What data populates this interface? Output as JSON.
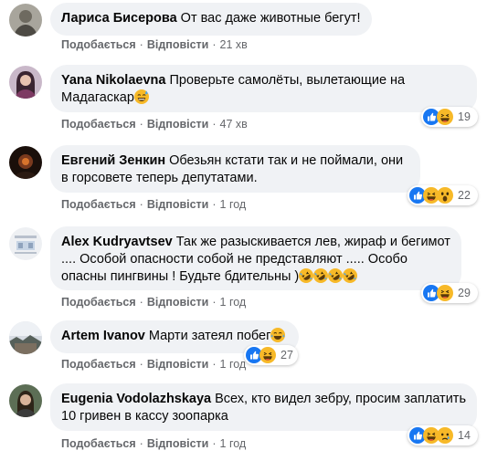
{
  "comments": [
    {
      "author": "Лариса Бисерова",
      "text": "От вас даже животные бегут!",
      "like": "Подобається",
      "reply": "Відповісти",
      "time": "21 хв"
    },
    {
      "author": "Yana Nikolaevna",
      "text": "Проверьте самолёты, вылетающие на Мадагаскар",
      "emoji": "grinning-sweat-emoji",
      "like": "Подобається",
      "reply": "Відповісти",
      "time": "47 хв",
      "reactions": {
        "icons": [
          "like-reaction-icon",
          "haha-reaction-icon"
        ],
        "count": "19"
      }
    },
    {
      "author": "Евгений Зенкин",
      "text": "Обезьян кстати так и не поймали, они в горсовете теперь депутатами.",
      "like": "Подобається",
      "reply": "Відповісти",
      "time": "1 год",
      "reactions": {
        "icons": [
          "like-reaction-icon",
          "haha-reaction-icon",
          "wow-reaction-icon"
        ],
        "count": "22"
      }
    },
    {
      "author": "Alex Kudryavtsev",
      "text": "Так же разыскивается лев, жираф и бегимот .... Особой опасности собой не представляют ..... Особо опасны пингвины ! Будьте бдительны )",
      "emoji": "rofl-emoji x4",
      "like": "Подобається",
      "reply": "Відповісти",
      "time": "1 год",
      "reactions": {
        "icons": [
          "like-reaction-icon",
          "haha-reaction-icon"
        ],
        "count": "29"
      }
    },
    {
      "author": "Artem Ivanov",
      "text": "Марти затеял побег",
      "emoji": "tears-of-joy-emoji",
      "like": "Подобається",
      "reply": "Відповісти",
      "time": "1 год",
      "reactions": {
        "icons": [
          "like-reaction-icon",
          "haha-reaction-icon"
        ],
        "count": "27"
      }
    },
    {
      "author": "Eugenia Vodolazhskaya",
      "text": "Всех, кто видел зебру, просим заплатить 10 гривен в кассу зоопарка",
      "like": "Подобається",
      "reply": "Відповісти",
      "time": "1 год",
      "reactions": {
        "icons": [
          "like-reaction-icon",
          "haha-reaction-icon",
          "sad-reaction-icon"
        ],
        "count": "14"
      }
    }
  ],
  "colors": {
    "bubble": "#f0f2f5",
    "meta": "#65676b",
    "like_blue": "#1877f2",
    "emoji_yellow": "#f7b928"
  }
}
